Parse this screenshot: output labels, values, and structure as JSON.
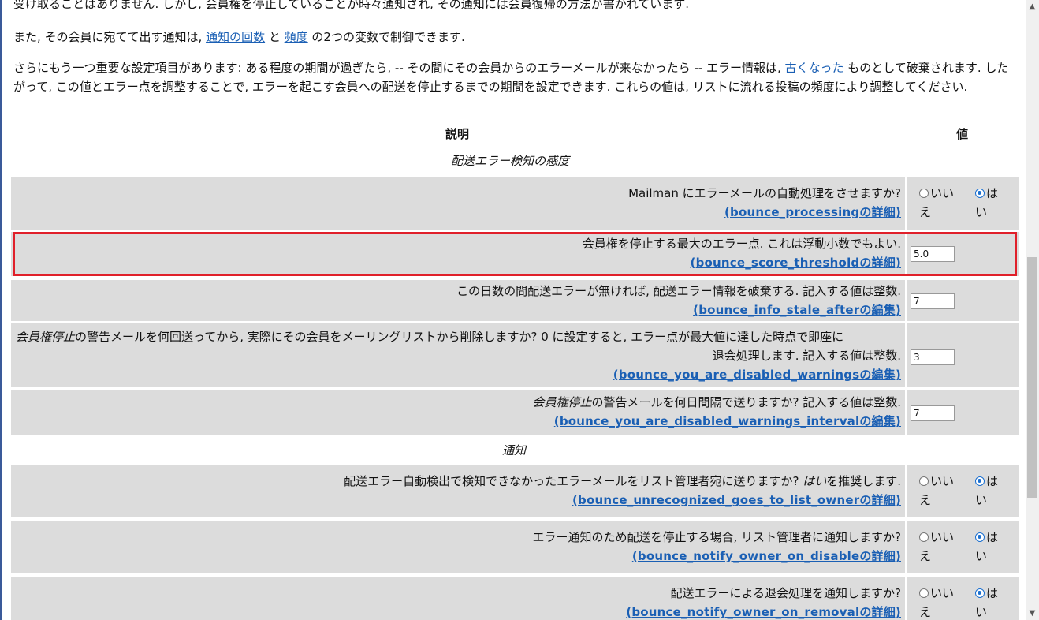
{
  "intro": {
    "line0": "受け取ることはありません. しかし, 会員権を停止していることが時々通知され, その通知には会員復帰の方法が書かれています.",
    "line1_pre": "また, その会員に宛てて出す通知は, ",
    "line1_link1": "通知の回数",
    "line1_mid": " と ",
    "line1_link2": "頻度",
    "line1_post": " の2つの変数で制御できます.",
    "line2_pre": "さらにもう一つ重要な設定項目があります: ある程度の期間が過ぎたら, -- その間にその会員からのエラーメールが来なかったら -- エラー情報は, ",
    "line2_link": "古くなった",
    "line2_post": " ものとして破棄されます. したがって, この値とエラー点を調整することで, エラーを起こす会員への配送を停止するまでの期間を設定できます. これらの値は, リストに流れる投稿の頻度により調整してください."
  },
  "table": {
    "col_desc": "説明",
    "col_value": "値",
    "cat1": "配送エラー検知の感度",
    "cat2": "通知",
    "radio_no_line1": "いい",
    "radio_no_line2": "え",
    "radio_yes_line1": "は",
    "radio_yes_line2": "い",
    "rows": [
      {
        "desc": "Mailman にエラーメールの自動処理をさせますか?",
        "link": "(bounce_processingの詳細)",
        "selected": "yes"
      },
      {
        "desc": "会員権を停止する最大のエラー点. これは浮動小数でもよい.",
        "link": "(bounce_score_thresholdの詳細)",
        "value": "5.0"
      },
      {
        "desc": "この日数の間配送エラーが無ければ, 配送エラー情報を破棄する. 記入する値は整数.",
        "link": "(bounce_info_stale_afterの編集)",
        "value": "7"
      },
      {
        "desc_em": "会員権停止",
        "desc_rest": "の警告メールを何回送ってから, 実際にその会員をメーリングリストから削除しますか? 0 に設定すると, エラー点が最大値に達した時点で即座に",
        "desc2": "退会処理します. 記入する値は整数.",
        "link": "(bounce_you_are_disabled_warningsの編集)",
        "value": "3"
      },
      {
        "desc_em": "会員権停止",
        "desc_rest": "の警告メールを何日間隔で送りますか? 記入する値は整数.",
        "link": "(bounce_you_are_disabled_warnings_intervalの編集)",
        "value": "7"
      },
      {
        "desc_pre": "配送エラー自動検出で検知できなかったエラーメールをリスト管理者宛に送りますか? ",
        "desc_em": "はい",
        "desc_post": "を推奨します.",
        "link": "(bounce_unrecognized_goes_to_list_ownerの詳細)",
        "selected": "yes"
      },
      {
        "desc": "エラー通知のため配送を停止する場合, リスト管理者に通知しますか?",
        "link": "(bounce_notify_owner_on_disableの詳細)",
        "selected": "yes"
      },
      {
        "desc": "配送エラーによる退会処理を通知しますか?",
        "link": "(bounce_notify_owner_on_removalの詳細)",
        "selected": "yes"
      }
    ]
  },
  "colors": {
    "link": "#1a5fb4",
    "row_bg": "#dcdcdc",
    "highlight": "#e0202a"
  }
}
